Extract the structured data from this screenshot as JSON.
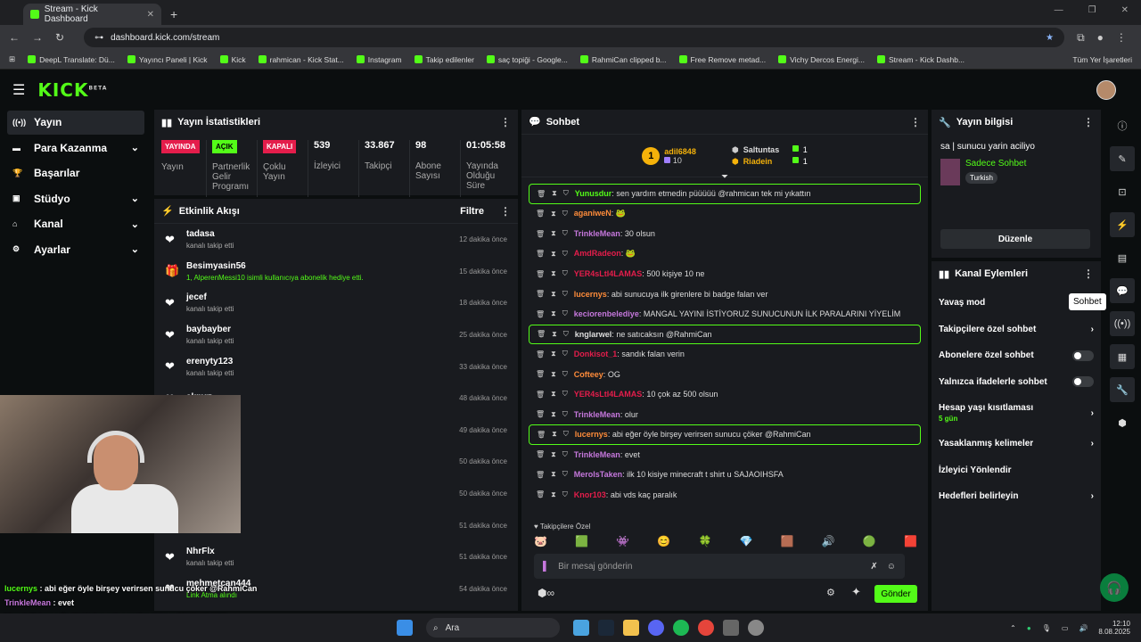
{
  "browser": {
    "tab_title": "Stream - Kick Dashboard",
    "url": "dashboard.kick.com/stream",
    "bookmarks": [
      "DeepL Translate: Dü...",
      "Yayıncı Paneli | Kick",
      "Kick",
      "rahmican - Kick Stat...",
      "Instagram",
      "Takip edilenler",
      "saç topiği - Google...",
      "RahmiCan clipped b...",
      "Free Remove metad...",
      "Vichy Dercos Energi...",
      "Stream - Kick Dashb..."
    ],
    "all_bookmarks": "Tüm Yer İşaretleri"
  },
  "header": {
    "logo": "KICK",
    "logo_sup": "BETA"
  },
  "sidebar": [
    {
      "icon": "((•))",
      "label": "Yayın",
      "chev": ""
    },
    {
      "icon": "▬",
      "label": "Para Kazanma",
      "chev": "⌄"
    },
    {
      "icon": "🏆",
      "label": "Başarılar",
      "chev": ""
    },
    {
      "icon": "▣",
      "label": "Stüdyo",
      "chev": "⌄"
    },
    {
      "icon": "⌂",
      "label": "Kanal",
      "chev": "⌄"
    },
    {
      "icon": "⚙",
      "label": "Ayarlar",
      "chev": "⌄"
    }
  ],
  "stats_panel": {
    "title": "Yayın İstatistikleri",
    "items": [
      {
        "badge": "YAYINDA",
        "label": "Yayın"
      },
      {
        "badge": "AÇIK",
        "label": "Partnerlik Gelir Programı"
      },
      {
        "badge": "KAPALI",
        "label": "Çoklu Yayın"
      },
      {
        "value": "539",
        "label": "İzleyici"
      },
      {
        "value": "33.867",
        "label": "Takipçi"
      },
      {
        "value": "98",
        "label": "Abone Sayısı"
      },
      {
        "value": "01:05:58",
        "label": "Yayında Olduğu Süre"
      }
    ]
  },
  "activity": {
    "title": "Etkinlik Akışı",
    "filter": "Filtre",
    "items": [
      {
        "icon": "❤",
        "name": "tadasa",
        "sub": "kanalı takip etti",
        "time": "12 dakika önce"
      },
      {
        "icon": "🎁",
        "name": "Besimyasin56",
        "sub": "1, AlperenMessi10 isimli kullanıcıya abonelik hediye etti.",
        "time": "15 dakika önce",
        "green": true
      },
      {
        "icon": "❤",
        "name": "jecef",
        "sub": "kanalı takip etti",
        "time": "18 dakika önce"
      },
      {
        "icon": "❤",
        "name": "baybayber",
        "sub": "kanalı takip etti",
        "time": "25 dakika önce"
      },
      {
        "icon": "❤",
        "name": "erenyty123",
        "sub": "kanalı takip etti",
        "time": "33 dakika önce"
      },
      {
        "icon": "❤",
        "name": "akmrz",
        "sub": "",
        "time": "48 dakika önce"
      },
      {
        "icon": "❤",
        "name": "",
        "sub": "",
        "time": "49 dakika önce"
      },
      {
        "icon": "❤",
        "name": "",
        "sub": "",
        "time": "50 dakika önce"
      },
      {
        "icon": "❤",
        "name": "",
        "sub": "",
        "time": "50 dakika önce"
      },
      {
        "icon": "❤",
        "name": "",
        "sub": "kanalı takip etti",
        "time": "51 dakika önce"
      },
      {
        "icon": "❤",
        "name": "NhrFlx",
        "sub": "kanalı takip etti",
        "time": "51 dakika önce"
      },
      {
        "icon": "❤",
        "name": "mehmetcan444",
        "sub": "Link Atma alındı",
        "time": "54 dakika önce",
        "green": true
      }
    ]
  },
  "cam_overlay": [
    {
      "name": "lucernys",
      "text": "abi eğer öyle birşey verirsen sunucu çöker @RahmiCan",
      "color": "#53fc18"
    },
    {
      "name": "TrinkleMean",
      "text": "evet",
      "color": "#c678dd"
    },
    {
      "name": "MerolsTaken",
      "text": "ilk 10 kisiye minecraft t shirt u SAJAOIHSFA",
      "color": "#c678dd"
    },
    {
      "name": "Kno",
      "text": "abi vds kaç paralık",
      "color": "#e41d4b"
    }
  ],
  "chat": {
    "title": "Sohbet",
    "top_gifter": {
      "rank": "1",
      "name": "adil6848",
      "count": "10"
    },
    "others": [
      {
        "name": "Saltuntas",
        "count": "1",
        "color": "#ddd"
      },
      {
        "name": "Riadein",
        "count": "1",
        "color": "#f5b20a"
      }
    ],
    "messages": [
      {
        "name": "Yunusdur",
        "text": "sen yardım etmedin püüüüü @rahmican tek mi yıkattın",
        "color": "#53fc18",
        "hl": true
      },
      {
        "name": "aganiweN",
        "text": "🐸",
        "color": "#ff8c3a"
      },
      {
        "name": "TrinkleMean",
        "text": "30 olsun",
        "color": "#c678dd"
      },
      {
        "name": "AmdRadeon",
        "text": "🐸",
        "color": "#e41d4b"
      },
      {
        "name": "YER4sLtI4LAMAS",
        "text": "500 kişiye 10 ne",
        "color": "#e41d4b"
      },
      {
        "name": "lucernys",
        "text": "abi sunucuya ilk girenlere bi badge falan ver",
        "color": "#ff8c3a"
      },
      {
        "name": "keciorenbelediye",
        "text": "MANGAL YAYINI İSTİYORUZ SUNUCUNUN İLK PARALARINI YİYELİM",
        "color": "#c678dd"
      },
      {
        "name": "knglarwel",
        "text": "ne satıcaksın @RahmiCan",
        "color": "#ddd",
        "hl": true
      },
      {
        "name": "Donkisot_1",
        "text": "sandık falan verin",
        "color": "#e41d4b"
      },
      {
        "name": "Cofteey",
        "text": "OG",
        "color": "#ff8c3a"
      },
      {
        "name": "YER4sLtI4LAMAS",
        "text": "10 çok az 500 olsun",
        "color": "#e41d4b"
      },
      {
        "name": "TrinkleMean",
        "text": "olur",
        "color": "#c678dd"
      },
      {
        "name": "lucernys",
        "text": "abi eğer öyle birşey verirsen sunucu çöker @RahmiCan",
        "color": "#ff8c3a",
        "hl": true
      },
      {
        "name": "TrinkleMean",
        "text": "evet",
        "color": "#c678dd"
      },
      {
        "name": "MerolsTaken",
        "text": "ilk 10 kisiye minecraft t shirt u SAJAOIHSFA",
        "color": "#c678dd"
      },
      {
        "name": "Knor103",
        "text": "abi vds kaç paralık",
        "color": "#e41d4b"
      }
    ],
    "follower_only": "Takipçilere Özel",
    "placeholder": "Bir mesaj gönderin",
    "send": "Gönder"
  },
  "stream_info": {
    "title": "Yayın bilgisi",
    "stream_title": "sa | sunucu yarin aciliyo",
    "category": "Sadece Sohbet",
    "tag": "Turkish",
    "edit": "Düzenle"
  },
  "channel_actions": {
    "title": "Kanal Eylemleri",
    "items": [
      {
        "label": "Yavaş mod",
        "kind": "none"
      },
      {
        "label": "Takipçilere özel sohbet",
        "kind": "chev"
      },
      {
        "label": "Abonelere özel sohbet",
        "kind": "toggle"
      },
      {
        "label": "Yalnızca ifadelerle sohbet",
        "kind": "toggle"
      },
      {
        "label": "Hesap yaşı kısıtlaması",
        "sub": "5 gün",
        "kind": "chev"
      },
      {
        "label": "Yasaklanmış kelimeler",
        "kind": "chev"
      },
      {
        "label": "İzleyici Yönlendir",
        "kind": "none"
      },
      {
        "label": "Hedefleri belirleyin",
        "kind": "chev"
      }
    ]
  },
  "tooltip": "Sohbet",
  "rail": [
    "ⓘ",
    "✎",
    "⊡",
    "⚡",
    "▤",
    "💬",
    "((•))",
    "▦",
    "🔧",
    "⬢"
  ],
  "taskbar": {
    "search": "Ara",
    "time": "12:10",
    "date": "8.08.2025"
  },
  "colors": {
    "accent": "#53fc18",
    "panel": "#191b1f",
    "bg": "#0b0e0f"
  }
}
